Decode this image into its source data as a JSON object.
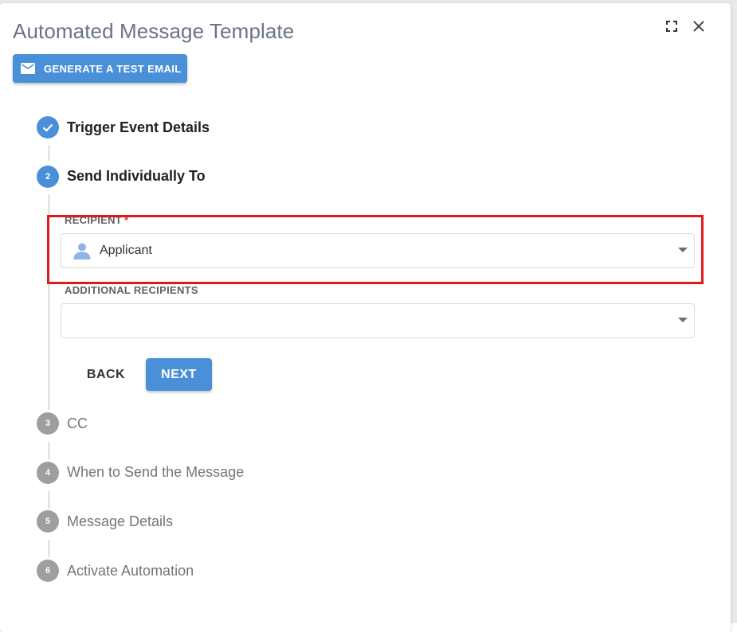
{
  "dialog": {
    "title": "Automated Message Template",
    "generate_button_label": "GENERATE A TEST EMAIL"
  },
  "steps": [
    {
      "number": "",
      "label": "Trigger Event Details",
      "status": "completed"
    },
    {
      "number": "2",
      "label": "Send Individually To",
      "status": "active"
    },
    {
      "number": "3",
      "label": "CC",
      "status": "inactive"
    },
    {
      "number": "4",
      "label": "When to Send the Message",
      "status": "inactive"
    },
    {
      "number": "5",
      "label": "Message Details",
      "status": "inactive"
    },
    {
      "number": "6",
      "label": "Activate Automation",
      "status": "inactive"
    }
  ],
  "recipient": {
    "label": "RECIPIENT",
    "required_marker": "*",
    "value": "Applicant",
    "icon": "person-icon"
  },
  "additional_recipients": {
    "label": "ADDITIONAL RECIPIENTS",
    "value": ""
  },
  "actions": {
    "back_label": "BACK",
    "next_label": "NEXT"
  },
  "colors": {
    "primary": "#4a90d9",
    "inactive_step": "#9e9e9e",
    "highlight": "#e0191f",
    "required": "#e53935"
  }
}
